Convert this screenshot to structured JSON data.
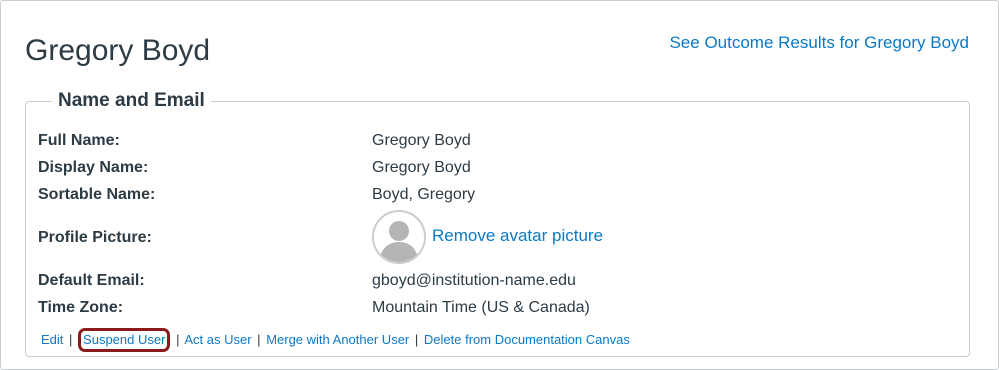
{
  "header": {
    "user_name": "Gregory Boyd",
    "outcome_link": "See Outcome Results for Gregory Boyd"
  },
  "section": {
    "legend": "Name and Email",
    "fields": [
      {
        "label": "Full Name:",
        "value": "Gregory Boyd"
      },
      {
        "label": "Display Name:",
        "value": "Gregory Boyd"
      },
      {
        "label": "Sortable Name:",
        "value": "Boyd, Gregory"
      },
      {
        "label": "Profile Picture:",
        "value": "Remove avatar picture"
      },
      {
        "label": "Default Email:",
        "value": "gboyd@institution-name.edu"
      },
      {
        "label": "Time Zone:",
        "value": "Mountain Time (US & Canada)"
      }
    ]
  },
  "actions": {
    "edit": "Edit",
    "suspend": "Suspend User",
    "act_as": "Act as User",
    "merge": "Merge with Another User",
    "delete": "Delete from Documentation Canvas",
    "separator": "|"
  },
  "colors": {
    "link": "#0b79c5",
    "text": "#2d3b45",
    "highlight": "#8b1a1a"
  }
}
